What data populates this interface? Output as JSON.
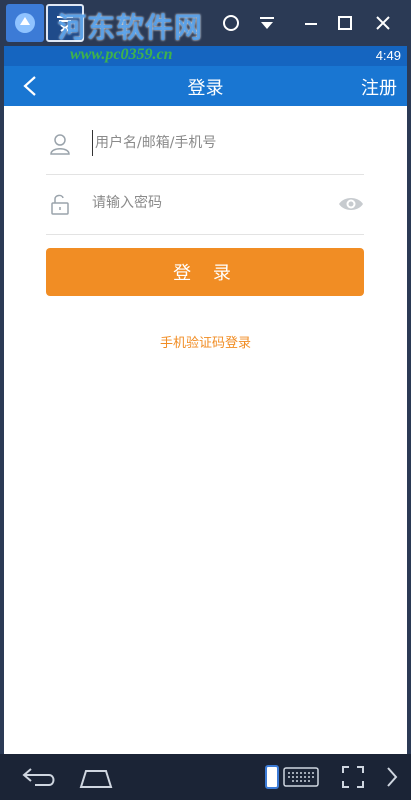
{
  "watermark": {
    "title": "河东软件网",
    "url": "www.pc0359.cn"
  },
  "status_bar": {
    "time": "4:49"
  },
  "app_bar": {
    "title": "登录",
    "register_label": "注册"
  },
  "form": {
    "username_placeholder": "用户名/邮箱/手机号",
    "username_value": "",
    "password_placeholder": "请输入密码",
    "password_value": "",
    "login_label": "登 录",
    "sms_login_label": "手机验证码登录"
  },
  "colors": {
    "app_bar": "#1976d2",
    "accent_orange": "#f18d24",
    "emulator_chrome": "#2b3a55"
  },
  "icons": {
    "back": "chevron-left-icon",
    "user": "user-icon",
    "lock": "unlock-icon",
    "eye": "eye-icon",
    "nav_back": "back-arrow-icon",
    "nav_home": "home-icon",
    "keyboard": "keyboard-icon",
    "fullscreen": "fullscreen-icon",
    "more": "chevron-right-icon"
  }
}
